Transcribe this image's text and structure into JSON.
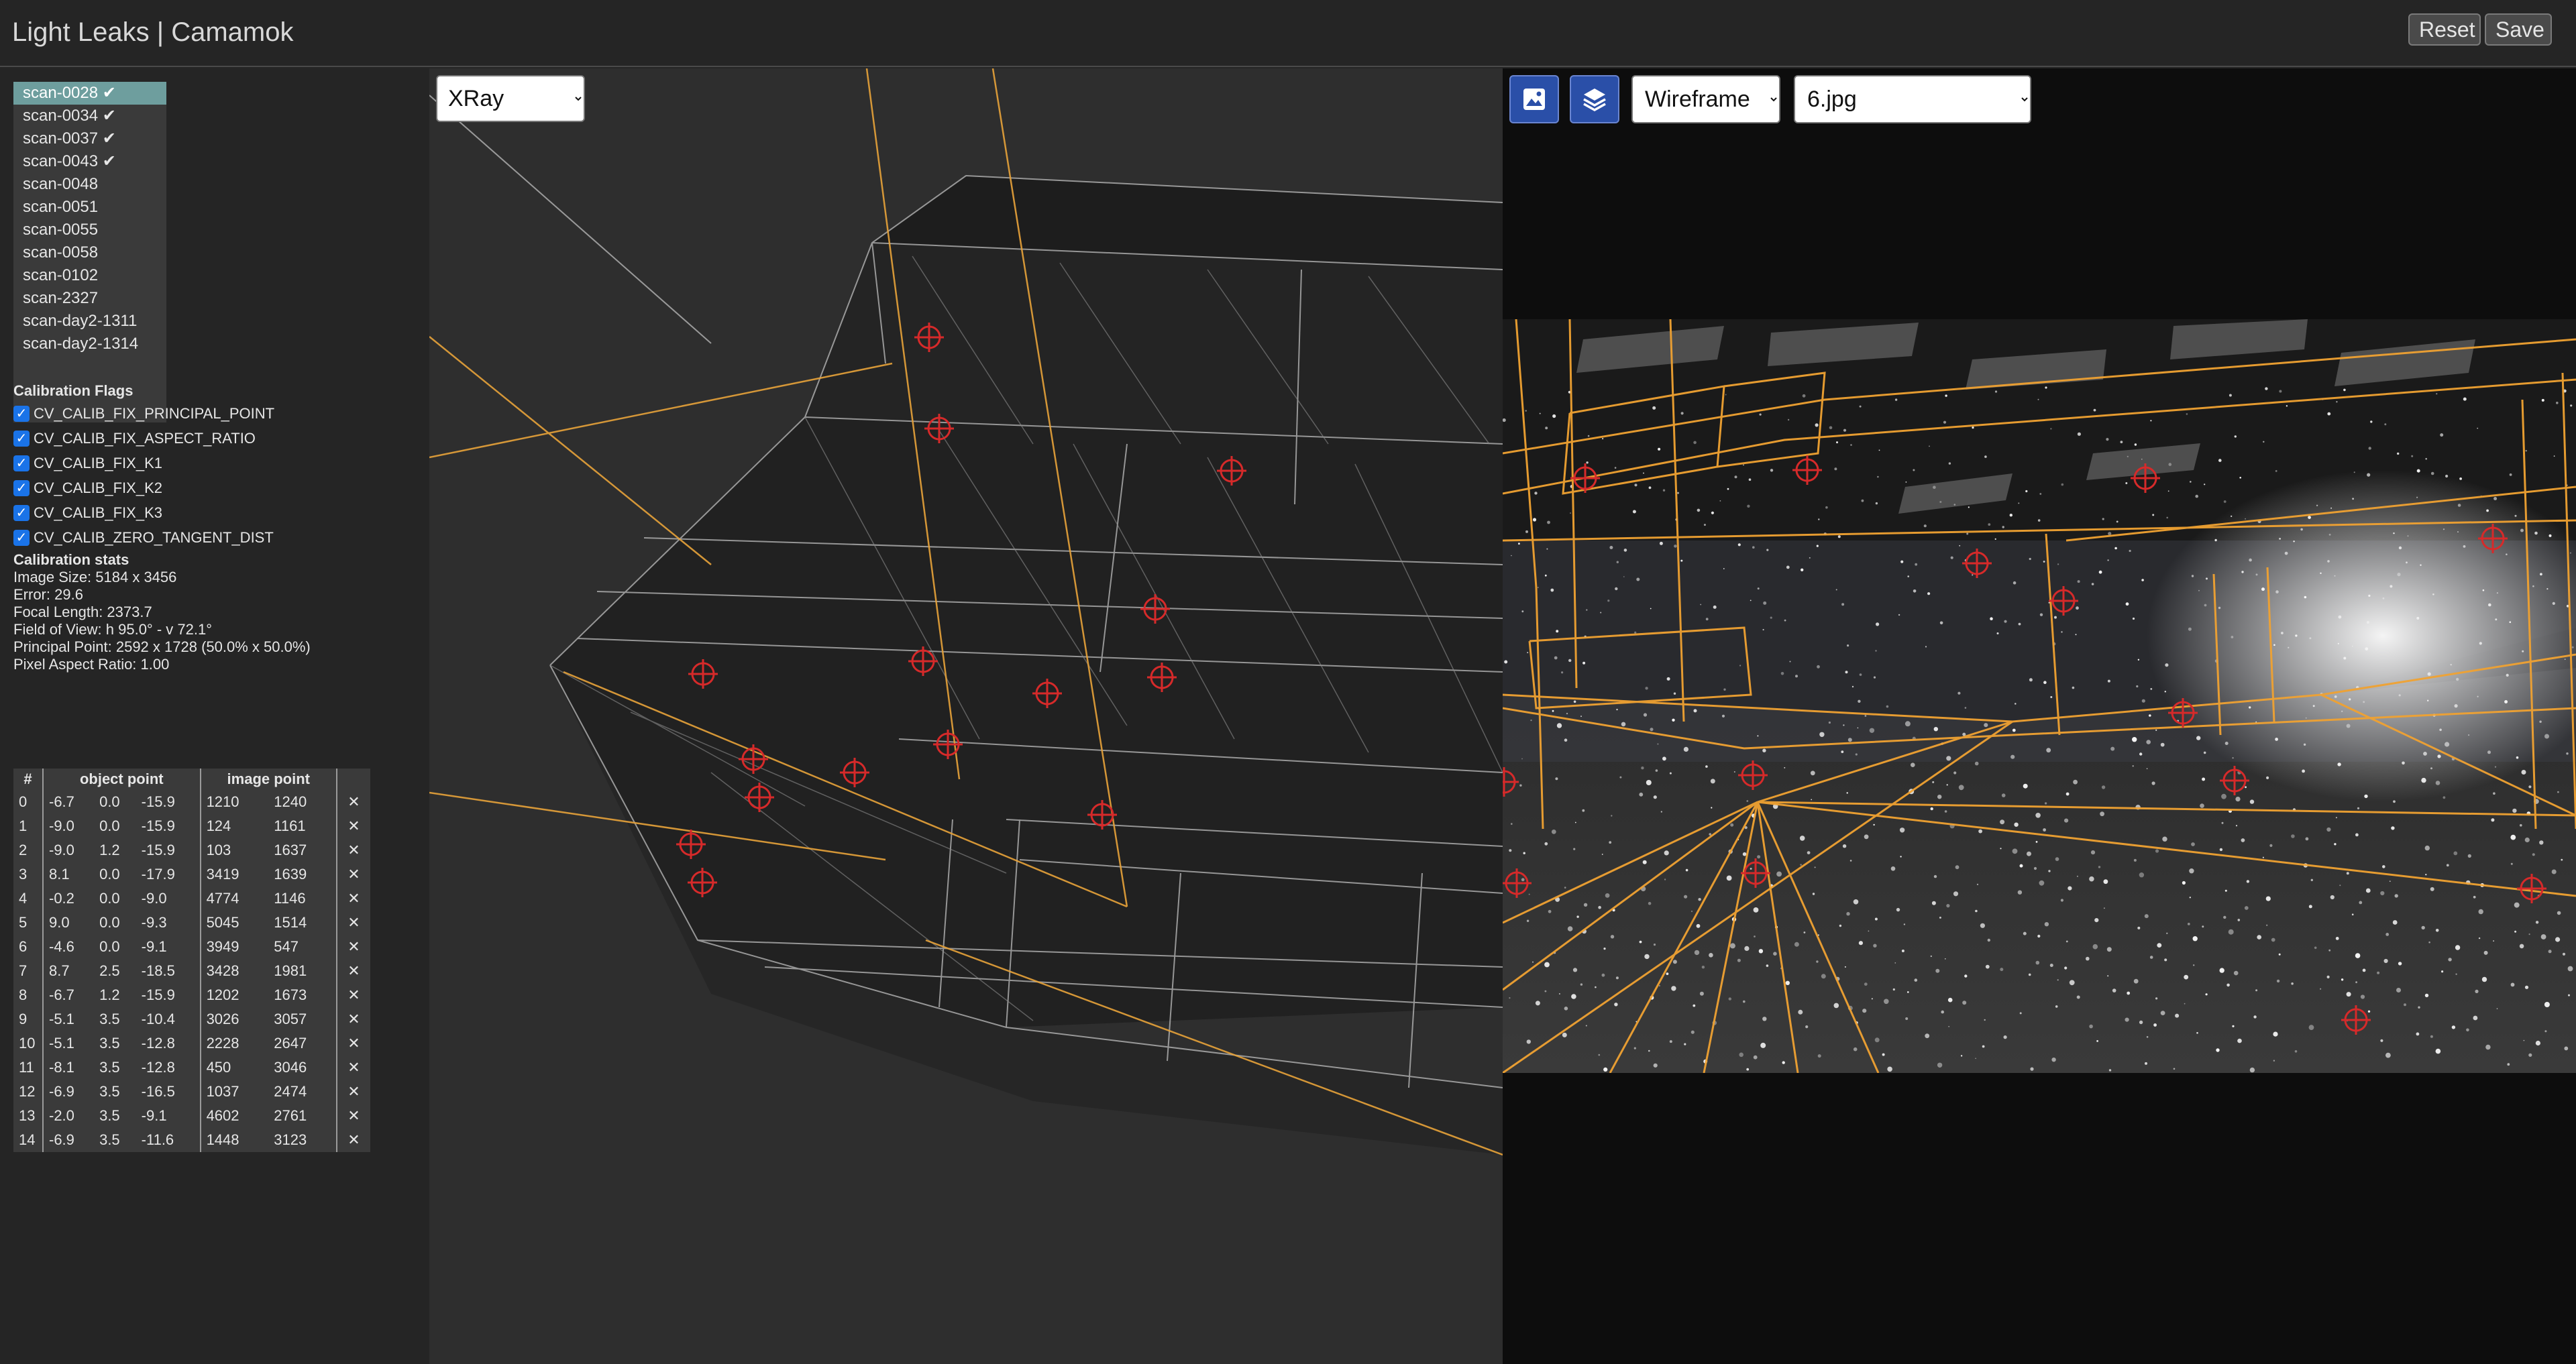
{
  "app": {
    "title": "Light Leaks | Camamok"
  },
  "toolbar": {
    "reset_label": "Reset",
    "save_label": "Save"
  },
  "scans": {
    "items": [
      {
        "label": "scan-0028 ✔",
        "selected": true
      },
      {
        "label": "scan-0034 ✔"
      },
      {
        "label": "scan-0037 ✔"
      },
      {
        "label": "scan-0043 ✔"
      },
      {
        "label": "scan-0048"
      },
      {
        "label": "scan-0051"
      },
      {
        "label": "scan-0055"
      },
      {
        "label": "scan-0058"
      },
      {
        "label": "scan-0102"
      },
      {
        "label": "scan-2327"
      },
      {
        "label": "scan-day2-1311"
      },
      {
        "label": "scan-day2-1314"
      }
    ]
  },
  "calibration_flags": {
    "title": "Calibration Flags",
    "items": [
      {
        "label": "CV_CALIB_FIX_PRINCIPAL_POINT",
        "checked": true
      },
      {
        "label": "CV_CALIB_FIX_ASPECT_RATIO",
        "checked": true
      },
      {
        "label": "CV_CALIB_FIX_K1",
        "checked": true
      },
      {
        "label": "CV_CALIB_FIX_K2",
        "checked": true
      },
      {
        "label": "CV_CALIB_FIX_K3",
        "checked": true
      },
      {
        "label": "CV_CALIB_ZERO_TANGENT_DIST",
        "checked": true
      }
    ]
  },
  "calibration_stats": {
    "title": "Calibration stats",
    "lines": [
      "Image Size: 5184 x 3456",
      "Error: 29.6",
      "Focal Length: 2373.7",
      "Field of View: h 95.0° - v 72.1°",
      "Principal Point: 2592 x 1728 (50.0% x 50.0%)",
      "Pixel Aspect Ratio: 1.00"
    ]
  },
  "points_table": {
    "headers": {
      "index": "#",
      "object": "object point",
      "image": "image point"
    },
    "delete_symbol": "✕",
    "rows": [
      {
        "i": "0",
        "ox": "-6.7",
        "oy": "0.0",
        "oz": "-15.9",
        "ix": "1210",
        "iy": "1240"
      },
      {
        "i": "1",
        "ox": "-9.0",
        "oy": "0.0",
        "oz": "-15.9",
        "ix": "124",
        "iy": "1161"
      },
      {
        "i": "2",
        "ox": "-9.0",
        "oy": "1.2",
        "oz": "-15.9",
        "ix": "103",
        "iy": "1637"
      },
      {
        "i": "3",
        "ox": "8.1",
        "oy": "0.0",
        "oz": "-17.9",
        "ix": "3419",
        "iy": "1639"
      },
      {
        "i": "4",
        "ox": "-0.2",
        "oy": "0.0",
        "oz": "-9.0",
        "ix": "4774",
        "iy": "1146"
      },
      {
        "i": "5",
        "ox": "9.0",
        "oy": "0.0",
        "oz": "-9.3",
        "ix": "5045",
        "iy": "1514"
      },
      {
        "i": "6",
        "ox": "-4.6",
        "oy": "0.0",
        "oz": "-9.1",
        "ix": "3949",
        "iy": "547"
      },
      {
        "i": "7",
        "ox": "8.7",
        "oy": "2.5",
        "oz": "-18.5",
        "ix": "3428",
        "iy": "1981"
      },
      {
        "i": "8",
        "ox": "-6.7",
        "oy": "1.2",
        "oz": "-15.9",
        "ix": "1202",
        "iy": "1673"
      },
      {
        "i": "9",
        "ox": "-5.1",
        "oy": "3.5",
        "oz": "-10.4",
        "ix": "3026",
        "iy": "3057"
      },
      {
        "i": "10",
        "ox": "-5.1",
        "oy": "3.5",
        "oz": "-12.8",
        "ix": "2228",
        "iy": "2647"
      },
      {
        "i": "11",
        "ox": "-8.1",
        "oy": "3.5",
        "oz": "-12.8",
        "ix": "450",
        "iy": "3046"
      },
      {
        "i": "12",
        "ox": "-6.9",
        "oy": "3.5",
        "oz": "-16.5",
        "ix": "1037",
        "iy": "2474"
      },
      {
        "i": "13",
        "ox": "-2.0",
        "oy": "3.5",
        "oz": "-9.1",
        "ix": "4602",
        "iy": "2761"
      },
      {
        "i": "14",
        "ox": "-6.9",
        "oy": "3.5",
        "oz": "-11.6",
        "ix": "1448",
        "iy": "3123"
      }
    ]
  },
  "viewport3d": {
    "mode_options": [
      "XRay"
    ],
    "mode_selected": "XRay"
  },
  "image_viewport": {
    "render_mode_selected": "Wireframe",
    "image_selected": "6.jpg",
    "image_icon": "image-icon",
    "layers_icon": "layers-icon"
  },
  "colors": {
    "accent_blue": "#2a4fa8",
    "selected_scan": "#6e9e9e",
    "wire_orange": "#e8a33a",
    "marker_red": "#d62a2a",
    "checkbox_blue": "#1a73e8"
  }
}
